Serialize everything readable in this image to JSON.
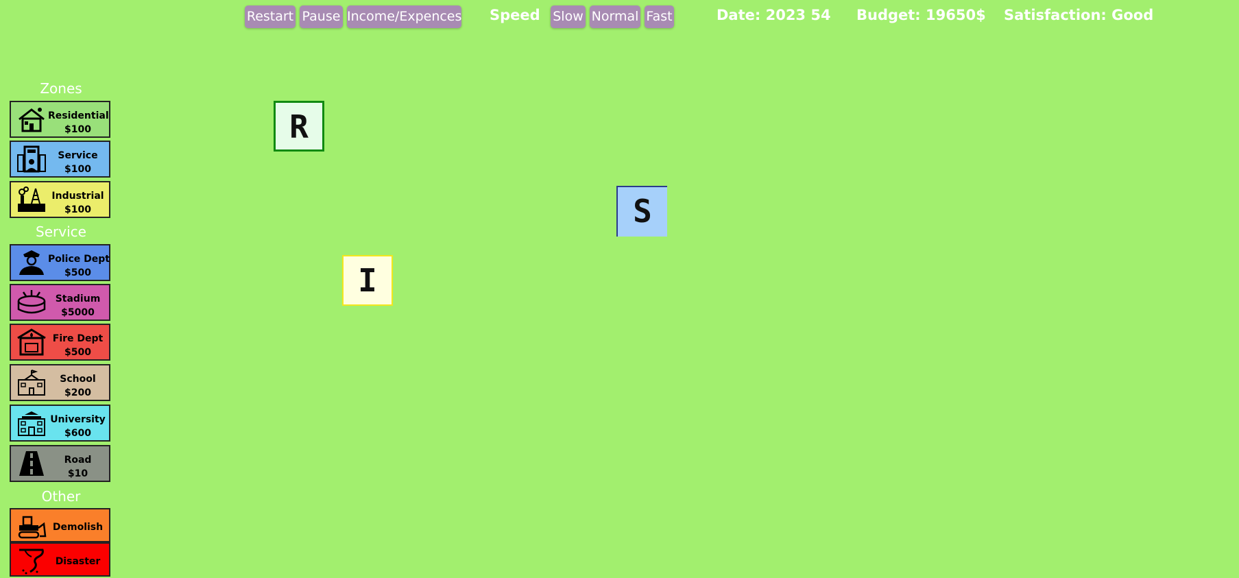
{
  "topbar": {
    "restart": "Restart",
    "pause": "Pause",
    "income": "Income/Expences",
    "speed_label": "Speed",
    "slow": "Slow",
    "normal": "Normal",
    "fast": "Fast",
    "date": "Date: 2023 54",
    "budget": "Budget: 19650$",
    "satisfaction": "Satisfaction: Good"
  },
  "sidebar": {
    "zones_heading": "Zones",
    "service_heading": "Service",
    "other_heading": "Other",
    "zones": [
      {
        "name": "Residential",
        "price": "$100",
        "color": "#99e07a",
        "icon": "house-icon"
      },
      {
        "name": "Service",
        "price": "$100",
        "color": "#74b9ef",
        "icon": "office-building-icon"
      },
      {
        "name": "Industrial",
        "price": "$100",
        "color": "#ebed6b",
        "icon": "factory-icon"
      }
    ],
    "services": [
      {
        "name": "Police Dept",
        "price": "$500",
        "color": "#5b8de8",
        "icon": "police-officer-icon"
      },
      {
        "name": "Stadium",
        "price": "$5000",
        "color": "#d05aac",
        "icon": "stadium-icon"
      },
      {
        "name": "Fire Dept",
        "price": "$500",
        "color": "#ee4d47",
        "icon": "fire-station-icon"
      },
      {
        "name": "School",
        "price": "$200",
        "color": "#d4bda1",
        "icon": "school-icon"
      },
      {
        "name": "University",
        "price": "$600",
        "color": "#69e3ee",
        "icon": "university-icon"
      },
      {
        "name": "Road",
        "price": "$10",
        "color": "#8a9186",
        "icon": "road-icon"
      }
    ],
    "other": [
      {
        "name": "Demolish",
        "color": "#fa7f2a",
        "icon": "bulldozer-icon"
      },
      {
        "name": "Disaster",
        "color": "#fb0000",
        "icon": "tornado-icon"
      }
    ]
  },
  "map": {
    "tiles": [
      {
        "letter": "R",
        "zone": "residential",
        "fill": "#e6fce9",
        "border": "#118a11"
      },
      {
        "letter": "S",
        "zone": "service",
        "fill": "#a6d0fa",
        "border": "#2b3a8c"
      },
      {
        "letter": "I",
        "zone": "industrial",
        "fill": "#ffffe0",
        "border": "#f3e61d"
      }
    ]
  }
}
